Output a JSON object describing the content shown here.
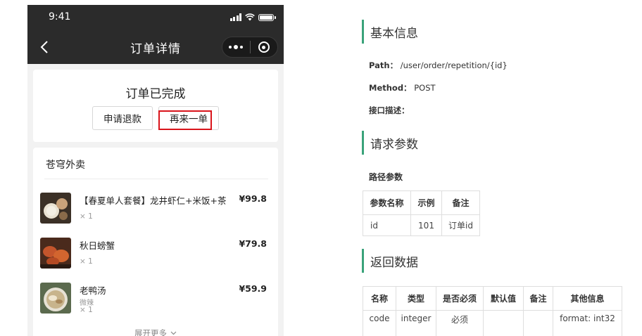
{
  "phone": {
    "status_bar": {
      "time": "9:41"
    },
    "nav_bar": {
      "title": "订单详情"
    },
    "status_card": {
      "order_status": "订单已完成",
      "refund_button": "申请退款",
      "reorder_button": "再来一单"
    },
    "items_card": {
      "shop_name": "苍穹外卖",
      "items": [
        {
          "name": "【春夏单人套餐】龙井虾仁+米饭+茶",
          "price": "¥99.8",
          "qty": "× 1",
          "spec": ""
        },
        {
          "name": "秋日螃蟹",
          "price": "¥79.8",
          "qty": "× 1",
          "spec": ""
        },
        {
          "name": "老鸭汤",
          "price": "¥59.9",
          "qty": "× 1",
          "spec": "微辣"
        }
      ],
      "expand_label": "展开更多"
    },
    "colors": {
      "highlight": "#d9141b",
      "nav_bg": "#2b2b2b"
    }
  },
  "doc": {
    "basic_info": {
      "heading": "基本信息",
      "path_label": "Path：",
      "path_value": "/user/order/repetition/{id}",
      "method_label": "Method：",
      "method_value": "POST",
      "desc_label": "接口描述："
    },
    "request_params": {
      "heading": "请求参数",
      "path_params_label": "路径参数",
      "table": {
        "headers": [
          "参数名称",
          "示例",
          "备注"
        ],
        "rows": [
          [
            "id",
            "101",
            "订单id"
          ]
        ]
      }
    },
    "response_data": {
      "heading": "返回数据",
      "table": {
        "headers": [
          "名称",
          "类型",
          "是否必须",
          "默认值",
          "备注",
          "其他信息"
        ],
        "rows": [
          [
            "code",
            "integer",
            "必须",
            "",
            "",
            "format: int32"
          ]
        ]
      }
    },
    "colors": {
      "accent": "#3aa37a"
    }
  }
}
